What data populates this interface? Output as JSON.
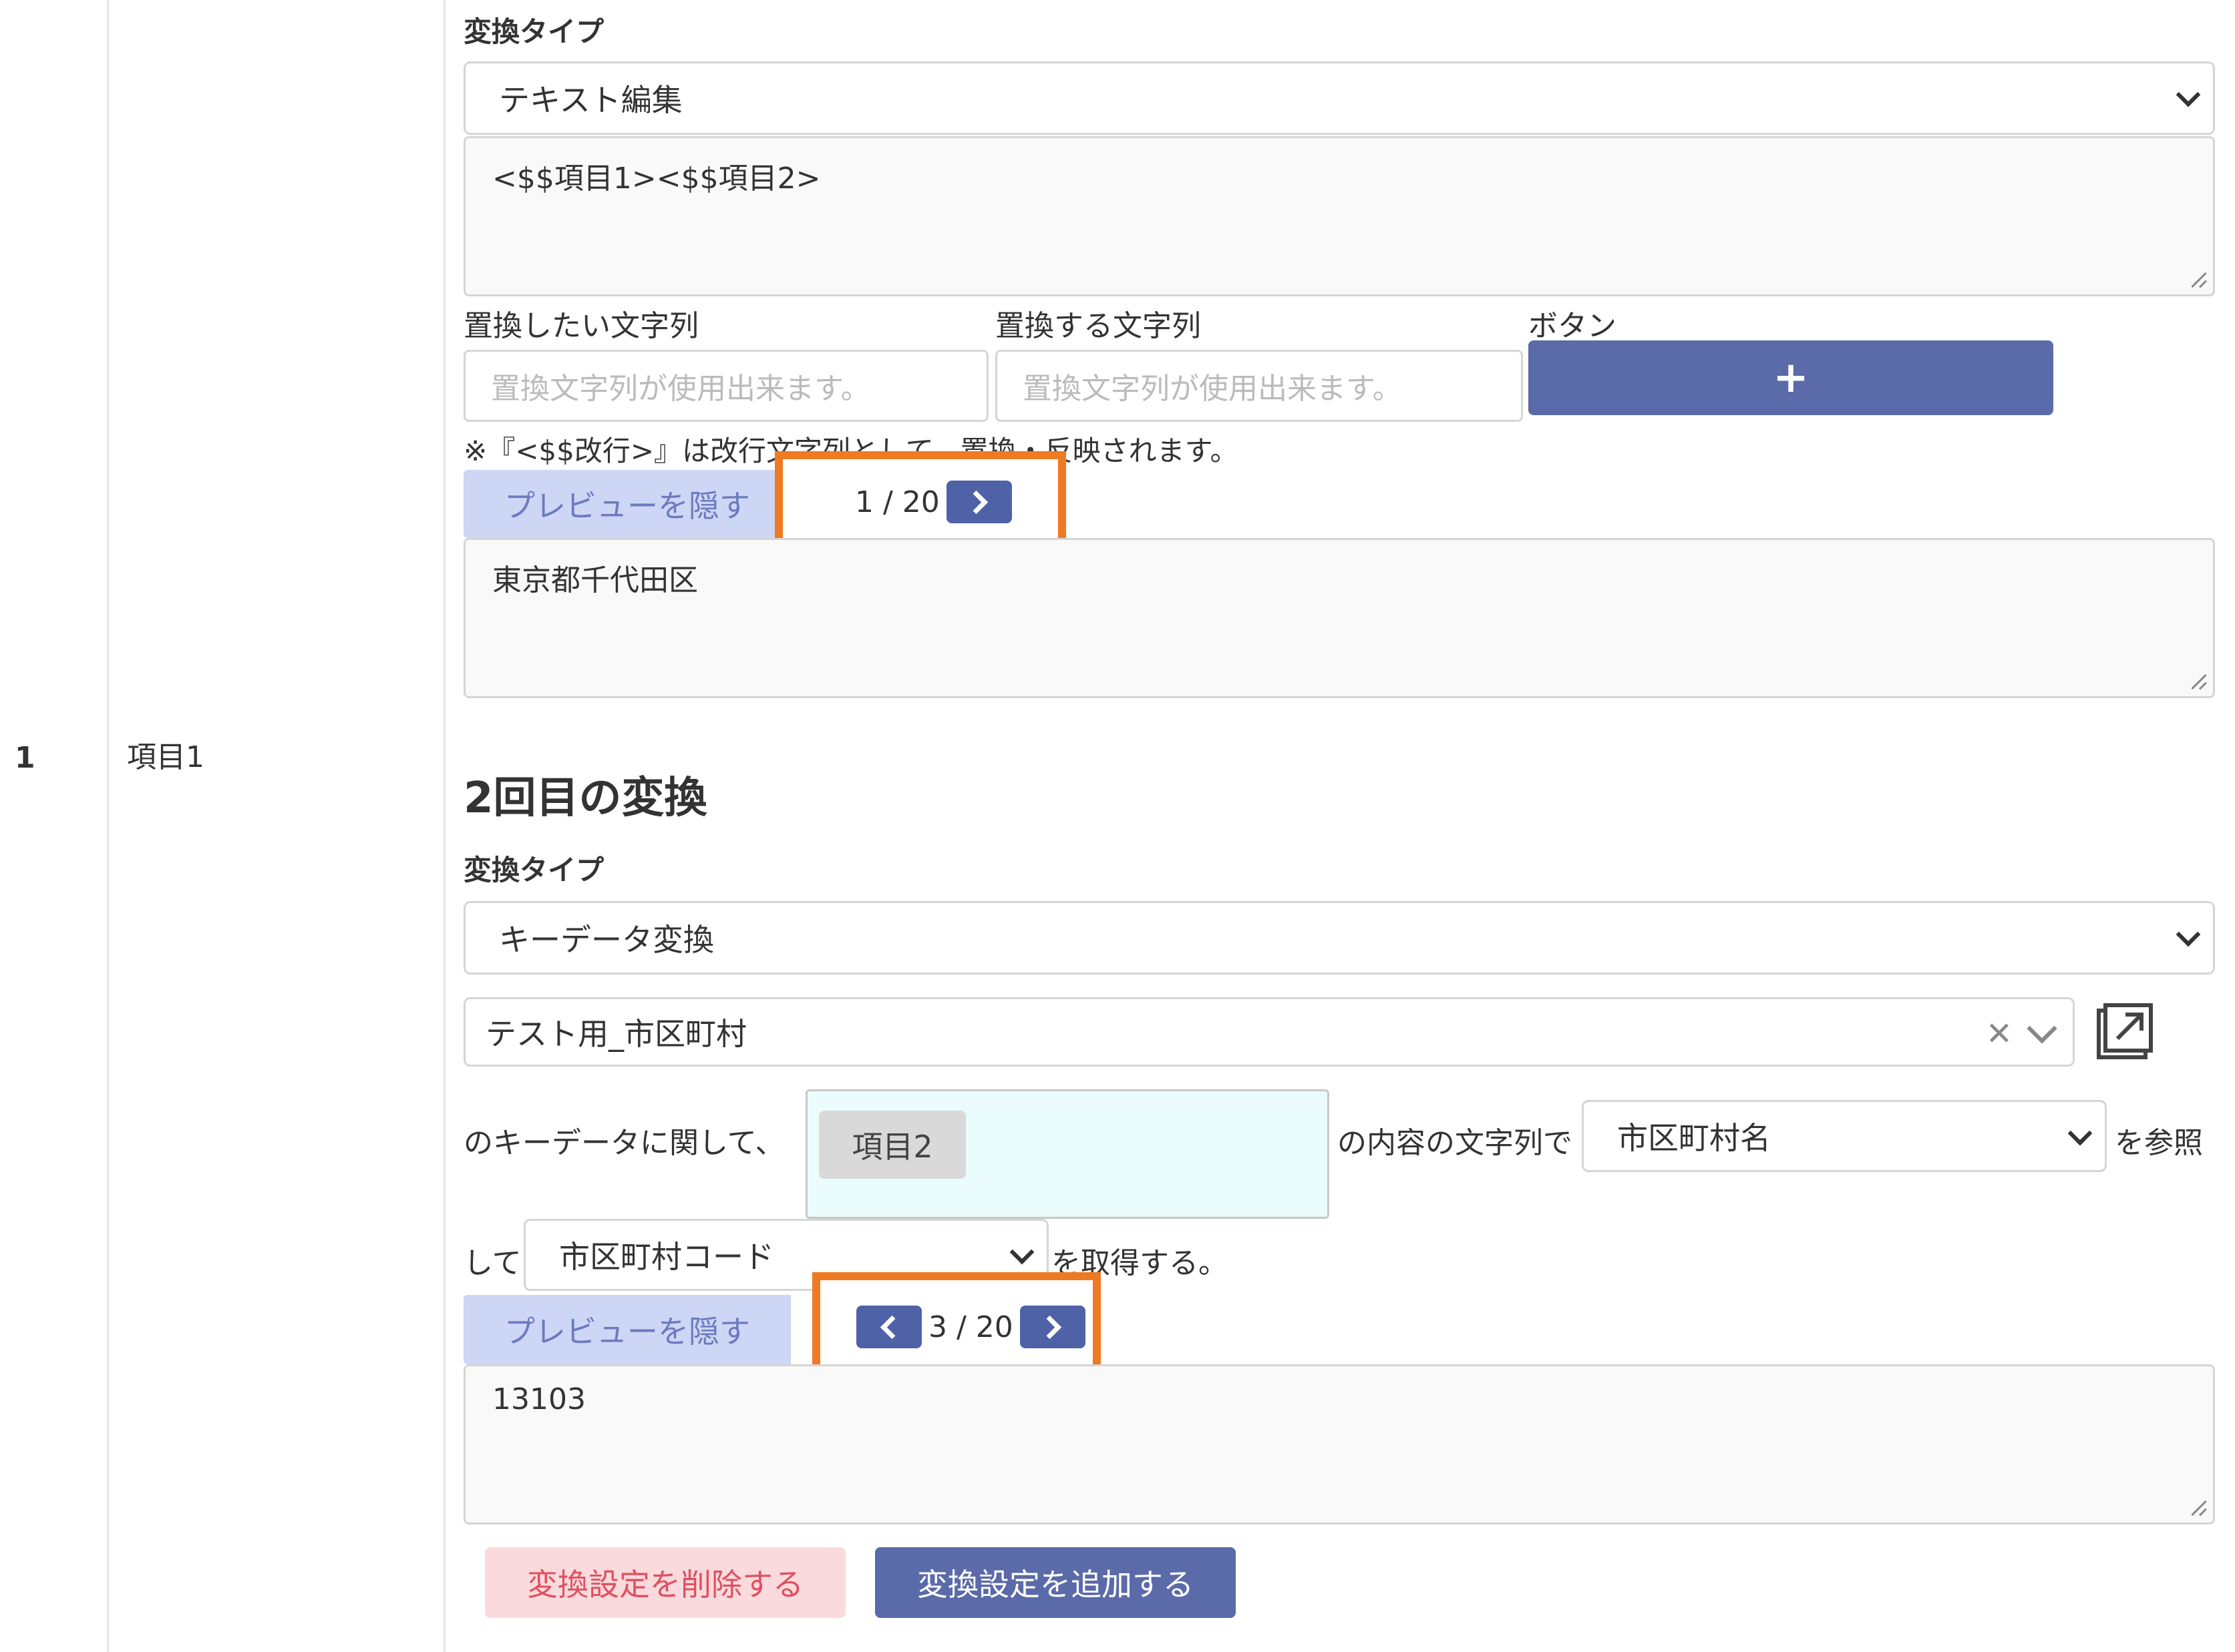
{
  "row": {
    "number": "1",
    "item_name": "項目1"
  },
  "first": {
    "type_label": "変換タイプ",
    "type_value": "テキスト編集",
    "expression": "<$$項目1><$$項目2>",
    "replace_from_label": "置換したい文字列",
    "replace_to_label": "置換する文字列",
    "button_col_label": "ボタン",
    "replace_from_placeholder": "置換文字列が使用出来ます。",
    "replace_to_placeholder": "置換文字列が使用出来ます。",
    "add_symbol": "+",
    "note": "※『<$$改行>』は改行文字列として、置換・反映されます。",
    "preview_toggle": "プレビューを隠す",
    "pager": "1 / 20",
    "preview_value": "東京都千代田区"
  },
  "second": {
    "heading": "2回目の変換",
    "type_label": "変換タイプ",
    "type_value": "キーデータ変換",
    "key_data_value": "テスト用_市区町村",
    "sentence_prefix": "のキーデータに関して、",
    "tag_value": "項目2",
    "sentence_middle": "の内容の文字列で",
    "ref_column_value": "市区町村名",
    "sentence_ref": "を参照",
    "sentence_shite": "して",
    "get_column_value": "市区町村コード",
    "sentence_end": "を取得する。",
    "preview_toggle": "プレビューを隠す",
    "pager": "3 / 20",
    "preview_value": "13103"
  },
  "actions": {
    "delete_label": "変換設定を削除する",
    "add_label": "変換設定を追加する"
  },
  "colors": {
    "accent": "#5b6aa8",
    "highlight": "#ee7a23",
    "danger_bg": "#fadadd",
    "danger_text": "#e05060"
  }
}
